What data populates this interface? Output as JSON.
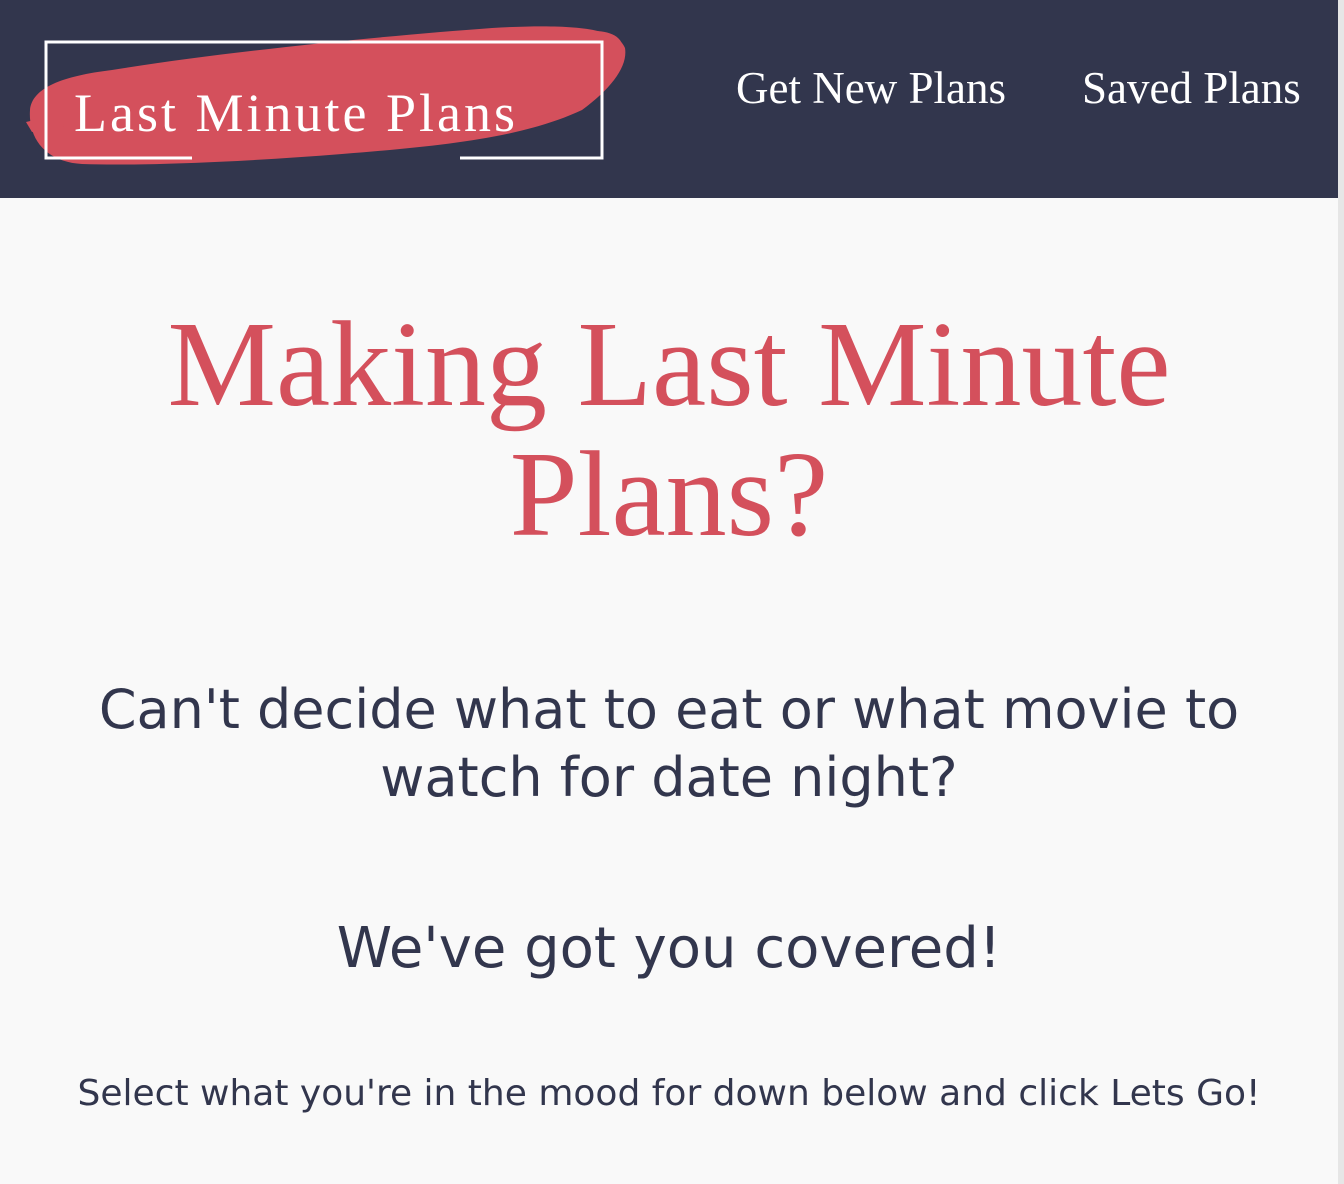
{
  "header": {
    "logo_text": "Last Minute Plans",
    "nav": [
      {
        "label": "Get New Plans"
      },
      {
        "label": "Saved Plans"
      }
    ],
    "colors": {
      "navbar_background": "#32364d",
      "brush_stroke": "#d4505c",
      "text": "#ffffff"
    }
  },
  "main": {
    "title": "Making Last Minute Plans?",
    "lead": "Can't decide what to eat or what movie to watch for date night?",
    "covered": "We've got you covered!",
    "instructions": "Select what you're in the mood for down below and click Lets Go!",
    "colors": {
      "title": "#d4505c",
      "body_text": "#32364d",
      "background": "#f9f9f9"
    }
  }
}
